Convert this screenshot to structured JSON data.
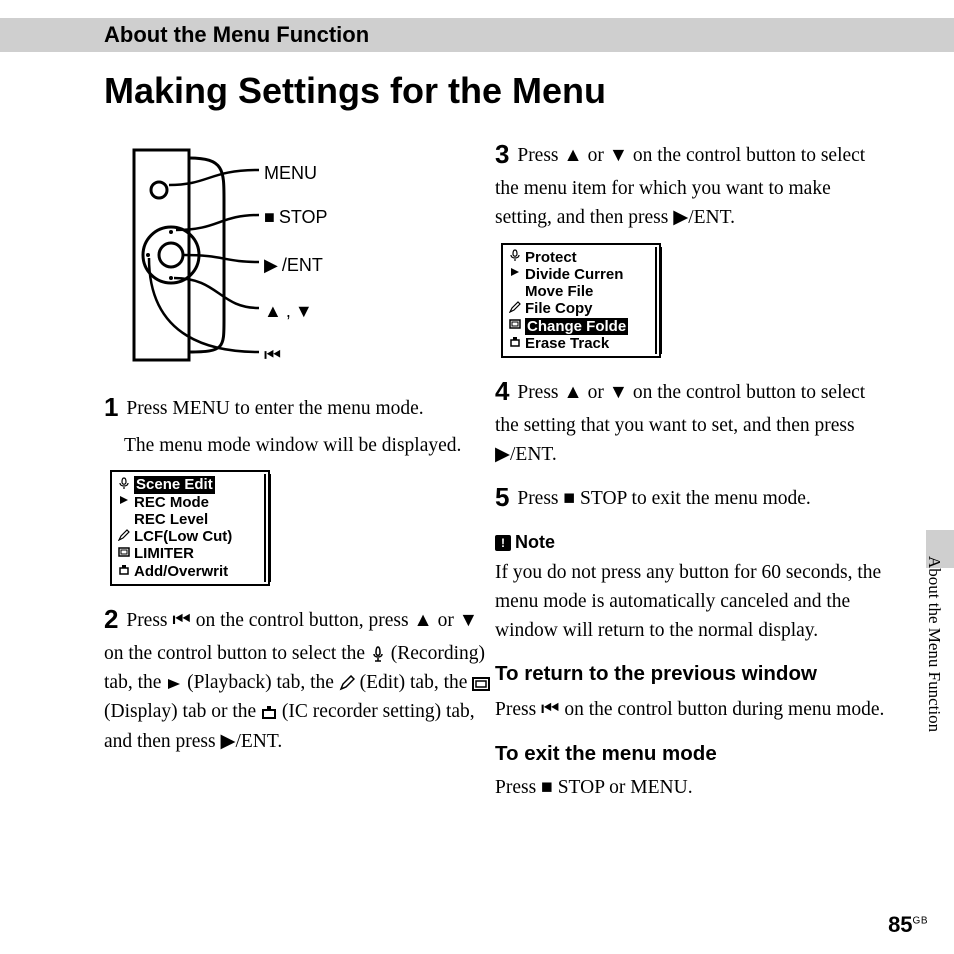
{
  "header": {
    "section": "About the Menu Function"
  },
  "title": "Making Settings for the Menu",
  "side_label": "About the Menu Function",
  "page_number": "85",
  "page_region": "GB",
  "diagram": {
    "labels": {
      "menu": "MENU",
      "stop": "STOP",
      "ent": "/ENT",
      "updown_sep": ", "
    }
  },
  "lcd1": {
    "rows": [
      {
        "icon": "mic",
        "text": "Scene Edit",
        "selected": true
      },
      {
        "icon": "play",
        "text": "REC Mode",
        "selected": false
      },
      {
        "icon": "blank",
        "text": "REC Level",
        "selected": false
      },
      {
        "icon": "edit",
        "text": "LCF(Low Cut)",
        "selected": false
      },
      {
        "icon": "disp",
        "text": "LIMITER",
        "selected": false
      },
      {
        "icon": "set",
        "text": "Add/Overwrit",
        "selected": false
      }
    ]
  },
  "lcd2": {
    "rows": [
      {
        "icon": "mic",
        "text": "Protect",
        "selected": false
      },
      {
        "icon": "play",
        "text": "Divide Curren",
        "selected": false
      },
      {
        "icon": "blank",
        "text": "Move File",
        "selected": false
      },
      {
        "icon": "edit",
        "text": "File Copy",
        "selected": false
      },
      {
        "icon": "disp",
        "text": "Change Folde",
        "selected": true
      },
      {
        "icon": "set",
        "text": "Erase Track",
        "selected": false
      }
    ]
  },
  "steps": {
    "s1a": "Press MENU to enter the menu mode.",
    "s1b": "The menu mode window will be displayed.",
    "s2a": "Press ",
    "s2b": " on the control button, press ",
    "s2c": " or ",
    "s2d": " on the control button to select the ",
    "s2e": " (Recording) tab, the ",
    "s2f": " (Playback) tab, the ",
    "s2g": " (Edit) tab, the ",
    "s2h": " (Display) tab or the ",
    "s2i": " (IC recorder setting) tab, and then press ",
    "s2j": "/ENT.",
    "s3a": "Press ",
    "s3b": " or ",
    "s3c": " on the control button to select the menu item for which you want to make setting, and then press ",
    "s3d": "/ENT.",
    "s4a": "Press ",
    "s4b": " or ",
    "s4c": " on the control button to select the setting that you want to set, and then press ",
    "s4d": "/ENT.",
    "s5a": "Press ",
    "s5b": " STOP to exit the menu mode."
  },
  "note": {
    "heading": "Note",
    "body": "If you do not press any button for 60 seconds, the menu mode is automatically canceled and the window will return to the normal display."
  },
  "subsections": {
    "return_h": "To return to the previous window",
    "return_b1": "Press ",
    "return_b2": " on the control button during menu mode.",
    "exit_h": "To exit the menu mode",
    "exit_b1": "Press ",
    "exit_b2": " STOP or MENU."
  }
}
